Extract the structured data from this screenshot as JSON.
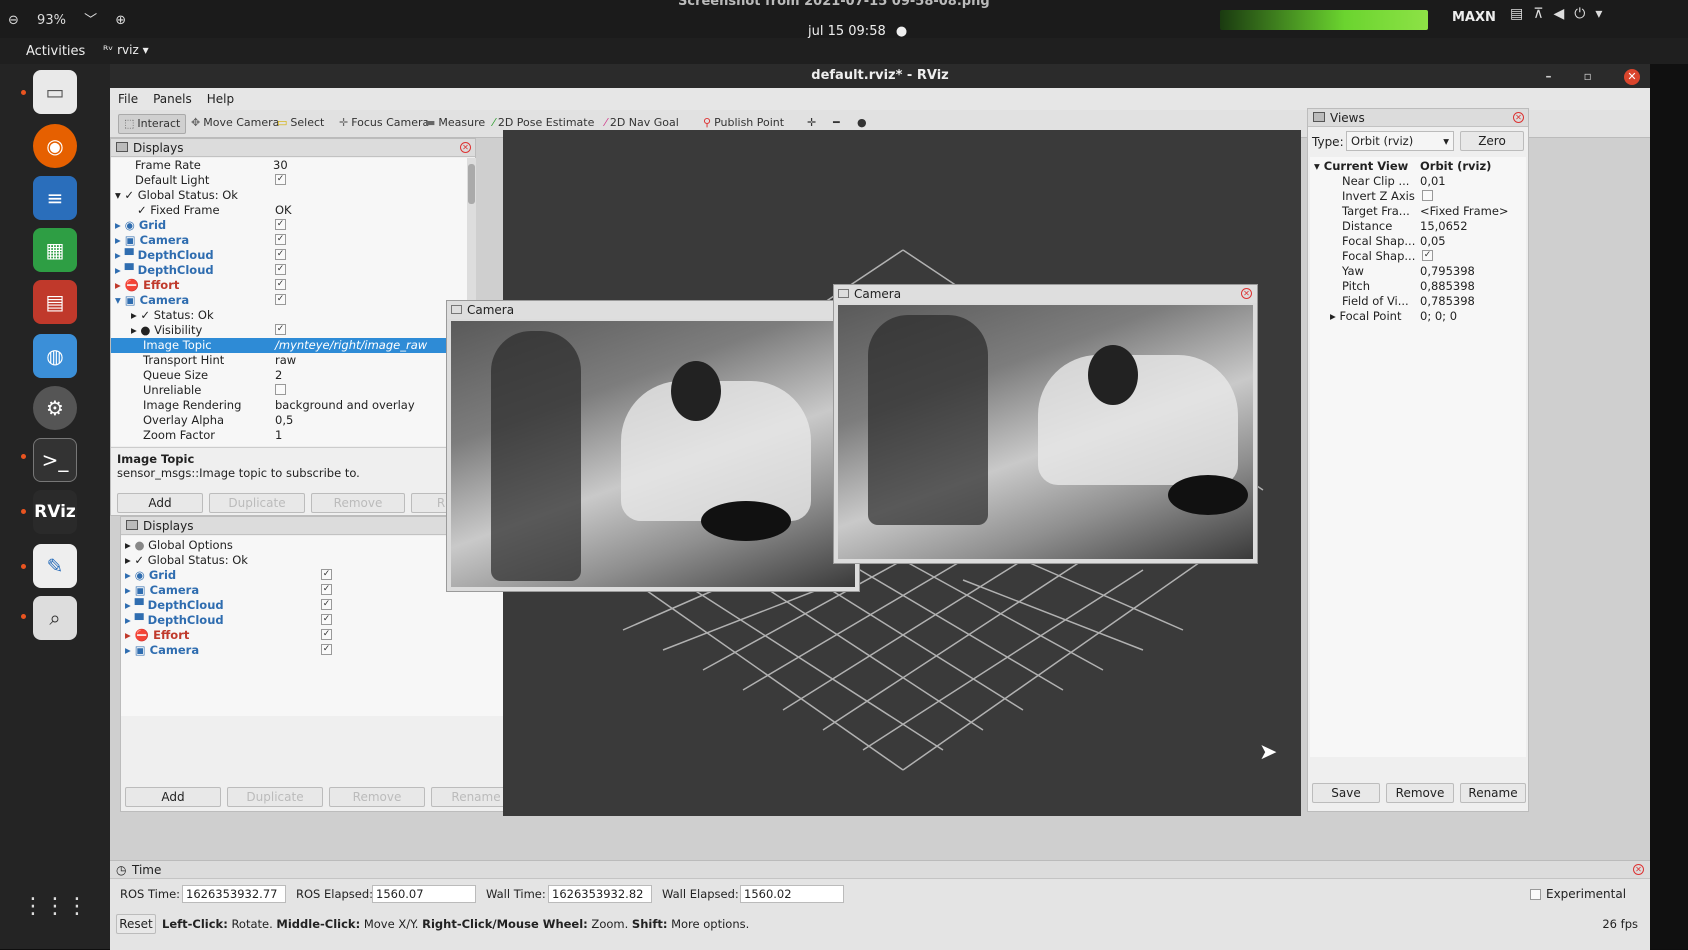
{
  "topbar": {
    "zoom_level": "93%",
    "screenshot_title": "Screenshot from 2021-07-15 09-58-08.png",
    "clock": "jul 15 09:58",
    "status_indicator": "●",
    "power_mode": "MAXN"
  },
  "activities": {
    "label": "Activities",
    "app_menu": "rviz"
  },
  "window": {
    "title": "default.rviz* - RViz",
    "minimize": "–",
    "maximize": "▫",
    "close": "✕"
  },
  "menu": {
    "file": "File",
    "panels": "Panels",
    "help": "Help"
  },
  "toolbar": {
    "interact": "Interact",
    "move_camera": "Move Camera",
    "select": "Select",
    "focus_camera": "Focus Camera",
    "measure": "Measure",
    "pose_estimate": "2D Pose Estimate",
    "nav_goal": "2D Nav Goal",
    "publish_point": "Publish Point"
  },
  "displays_top": {
    "title": "Displays",
    "rows": {
      "frame_rate": {
        "label": "Frame Rate",
        "value": "30"
      },
      "default_light": {
        "label": "Default Light"
      },
      "global_status": {
        "label": "Global Status: Ok"
      },
      "fixed_frame": {
        "label": "Fixed Frame",
        "value": "OK"
      },
      "grid": {
        "label": "Grid"
      },
      "camera1": {
        "label": "Camera"
      },
      "depth1": {
        "label": "DepthCloud"
      },
      "depth2": {
        "label": "DepthCloud"
      },
      "effort": {
        "label": "Effort"
      },
      "camera2": {
        "label": "Camera"
      },
      "status_ok": {
        "label": "Status: Ok"
      },
      "visibility": {
        "label": "Visibility"
      },
      "image_topic": {
        "label": "Image Topic",
        "value": "/mynteye/right/image_raw"
      },
      "transport_hint": {
        "label": "Transport Hint",
        "value": "raw"
      },
      "queue_size": {
        "label": "Queue Size",
        "value": "2"
      },
      "unreliable": {
        "label": "Unreliable"
      },
      "image_rendering": {
        "label": "Image Rendering",
        "value": "background and overlay"
      },
      "overlay_alpha": {
        "label": "Overlay Alpha",
        "value": "0,5"
      },
      "zoom_factor": {
        "label": "Zoom Factor",
        "value": "1"
      }
    },
    "desc_title": "Image Topic",
    "desc_text": "sensor_msgs::Image topic to subscribe to.",
    "buttons": {
      "add": "Add",
      "duplicate": "Duplicate",
      "remove": "Remove",
      "rename": "R"
    }
  },
  "displays_bottom": {
    "title": "Displays",
    "rows": {
      "global_options": "Global Options",
      "global_status": "Global Status: Ok",
      "grid": "Grid",
      "camera1": "Camera",
      "depth1": "DepthCloud",
      "depth2": "DepthCloud",
      "effort": "Effort",
      "camera2": "Camera"
    },
    "buttons": {
      "add": "Add",
      "duplicate": "Duplicate",
      "remove": "Remove",
      "rename": "Rename"
    }
  },
  "camera_left": {
    "title": "Camera"
  },
  "camera_right": {
    "title": "Camera"
  },
  "views": {
    "title": "Views",
    "type_label": "Type:",
    "type_value": "Orbit (rviz)",
    "zero": "Zero",
    "current_view": {
      "label": "Current View",
      "value": "Orbit (rviz)"
    },
    "props": {
      "near_clip": {
        "label": "Near Clip ...",
        "value": "0,01"
      },
      "invert_z": {
        "label": "Invert Z Axis"
      },
      "target_frame": {
        "label": "Target Fra...",
        "value": "<Fixed Frame>"
      },
      "distance": {
        "label": "Distance",
        "value": "15,0652"
      },
      "focal_shape1": {
        "label": "Focal Shap...",
        "value": "0,05"
      },
      "focal_shape2": {
        "label": "Focal Shap..."
      },
      "yaw": {
        "label": "Yaw",
        "value": "0,795398"
      },
      "pitch": {
        "label": "Pitch",
        "value": "0,885398"
      },
      "fov": {
        "label": "Field of Vi...",
        "value": "0,785398"
      },
      "focal_point": {
        "label": "Focal Point",
        "value": "0; 0; 0"
      }
    },
    "buttons": {
      "save": "Save",
      "remove": "Remove",
      "rename": "Rename"
    }
  },
  "time": {
    "title": "Time",
    "ros_time_label": "ROS Time:",
    "ros_time": "1626353932.77",
    "ros_elapsed_label": "ROS Elapsed:",
    "ros_elapsed": "1560.07",
    "wall_time_label": "Wall Time:",
    "wall_time": "1626353932.82",
    "wall_elapsed_label": "Wall Elapsed:",
    "wall_elapsed": "1560.02",
    "experimental": "Experimental"
  },
  "statusbar": {
    "reset": "Reset",
    "hint_left": "Left-Click:",
    "hint_left_text": " Rotate. ",
    "hint_middle": "Middle-Click:",
    "hint_middle_text": " Move X/Y. ",
    "hint_right": "Right-Click/Mouse Wheel:",
    "hint_right_text": " Zoom. ",
    "hint_shift": "Shift:",
    "hint_shift_text": " More options.",
    "fps": "26 fps"
  },
  "icons": [
    "zoom-out-icon",
    "chevron-down-icon",
    "zoom-in-icon",
    "files-icon",
    "firefox-icon",
    "writer-icon",
    "calc-icon",
    "impress-icon",
    "software-icon",
    "settings-icon",
    "terminal-icon",
    "rviz-icon",
    "text-editor-icon",
    "search-icon",
    "app-grid-icon",
    "mouse-cursor-icon"
  ]
}
